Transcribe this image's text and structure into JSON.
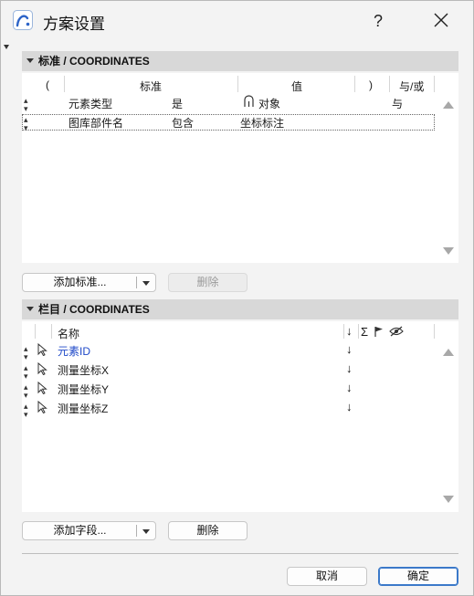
{
  "window": {
    "title": "方案设置",
    "help_label": "?"
  },
  "criteria_section": {
    "header": "标准 /  COORDINATES",
    "columns": {
      "paren_open": "(",
      "criteria": "标准",
      "value": "值",
      "paren_close": ")",
      "and_or": "与/或"
    },
    "rows": [
      {
        "element": "元素类型",
        "op": "是",
        "value": "对象",
        "and_or": "与"
      },
      {
        "element": "图库部件名",
        "op": "包含",
        "value": "坐标标注",
        "and_or": ""
      }
    ],
    "add_button": "添加标准...",
    "delete_button": "删除"
  },
  "fields_section": {
    "header": "栏目 /  COORDINATES",
    "columns": {
      "name": "名称",
      "sort": "↓",
      "sum": "Σ"
    },
    "rows": [
      {
        "name": "元素ID",
        "sort": "↓",
        "highlight": true
      },
      {
        "name": "测量坐标X",
        "sort": "↓",
        "highlight": false
      },
      {
        "name": "测量坐标Y",
        "sort": "↓",
        "highlight": false
      },
      {
        "name": "测量坐标Z",
        "sort": "↓",
        "highlight": false
      }
    ],
    "add_button": "添加字段...",
    "delete_button": "删除"
  },
  "footer": {
    "cancel": "取消",
    "ok": "确定"
  },
  "colors": {
    "accent": "#2d64c8",
    "highlight_text": "#1f49c8",
    "header_bg": "#d8d8d8"
  }
}
